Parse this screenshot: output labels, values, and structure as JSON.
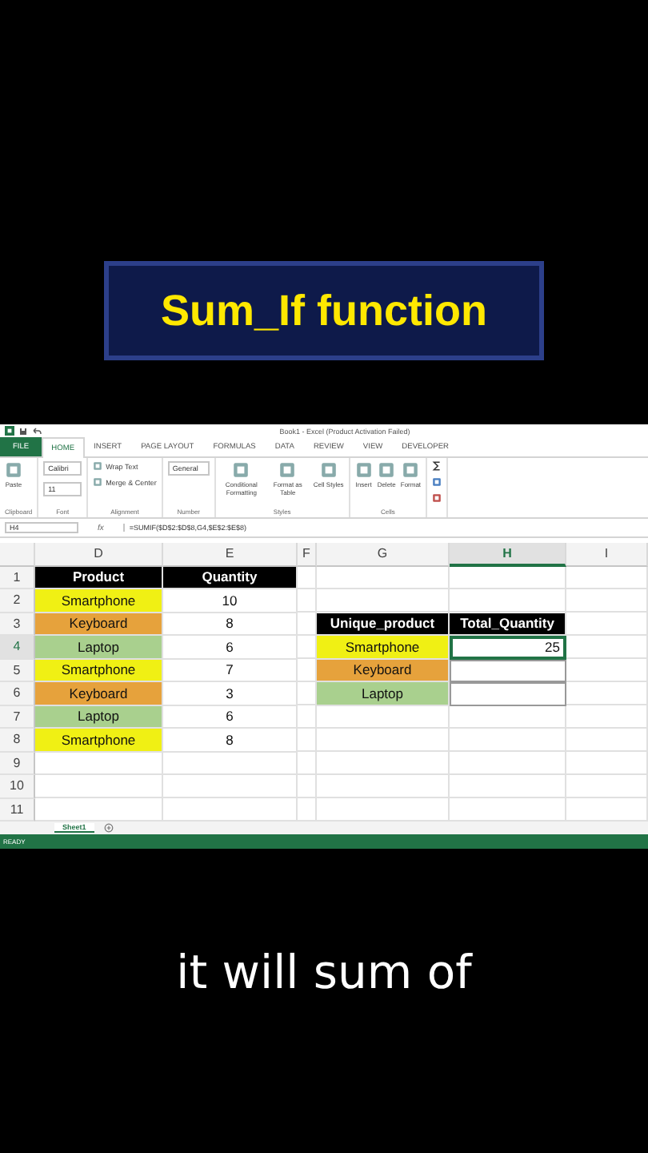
{
  "banner": {
    "title": "Sum_If function"
  },
  "window": {
    "title": "Book1 - Excel (Product Activation Failed)"
  },
  "tabs": [
    {
      "label": "FILE",
      "selected": false,
      "kind": "file"
    },
    {
      "label": "HOME",
      "selected": true,
      "kind": "tab"
    },
    {
      "label": "INSERT",
      "selected": false,
      "kind": "tab"
    },
    {
      "label": "PAGE LAYOUT",
      "selected": false,
      "kind": "tab"
    },
    {
      "label": "FORMULAS",
      "selected": false,
      "kind": "tab"
    },
    {
      "label": "DATA",
      "selected": false,
      "kind": "tab"
    },
    {
      "label": "REVIEW",
      "selected": false,
      "kind": "tab"
    },
    {
      "label": "VIEW",
      "selected": false,
      "kind": "tab"
    },
    {
      "label": "DEVELOPER",
      "selected": false,
      "kind": "tab"
    }
  ],
  "ribbon": {
    "groups": [
      {
        "label": "Clipboard",
        "items": [
          {
            "text": "Paste",
            "kind": "large"
          }
        ]
      },
      {
        "label": "Font",
        "items": [
          {
            "text": "Calibri",
            "kind": "dropdown"
          },
          {
            "text": "11",
            "kind": "dropdown"
          }
        ]
      },
      {
        "label": "Alignment",
        "items": [
          {
            "text": "Wrap Text",
            "kind": "small"
          },
          {
            "text": "Merge & Center",
            "kind": "small"
          }
        ]
      },
      {
        "label": "Number",
        "items": [
          {
            "text": "General",
            "kind": "dropdown"
          }
        ]
      },
      {
        "label": "Styles",
        "items": [
          {
            "text": "Conditional Formatting",
            "kind": "large"
          },
          {
            "text": "Format as Table",
            "kind": "large"
          },
          {
            "text": "Cell Styles",
            "kind": "large"
          }
        ]
      },
      {
        "label": "Cells",
        "items": [
          {
            "text": "Insert",
            "kind": "large"
          },
          {
            "text": "Delete",
            "kind": "large"
          },
          {
            "text": "Format",
            "kind": "large"
          }
        ]
      }
    ]
  },
  "formula_bar": {
    "name_box": "H4",
    "fx": "fx",
    "formula": "=SUMIF($D$2:$D$8,G4,$E$2:$E$8)"
  },
  "columns": [
    {
      "label": "D",
      "selected": false
    },
    {
      "label": "E",
      "selected": false
    },
    {
      "label": "F",
      "selected": false
    },
    {
      "label": "G",
      "selected": false
    },
    {
      "label": "H",
      "selected": true
    },
    {
      "label": "I",
      "selected": false
    }
  ],
  "rows": [
    {
      "number": "1",
      "selected": false,
      "d": {
        "text": "Product",
        "kind": "header",
        "selected": false
      },
      "e": {
        "text": "Quantity",
        "kind": "header",
        "selected": false
      }
    },
    {
      "number": "2",
      "selected": false,
      "d": {
        "text": "Smartphone",
        "kind": "product",
        "color": "#f0f014",
        "selected": false
      },
      "e": {
        "text": "10",
        "kind": "value",
        "selected": false
      }
    },
    {
      "number": "3",
      "selected": false,
      "d": {
        "text": "Keyboard",
        "kind": "product",
        "color": "#e6a23c",
        "selected": false
      },
      "e": {
        "text": "8",
        "kind": "value",
        "selected": false
      },
      "g": {
        "text": "Unique_product",
        "kind": "header",
        "selected": false
      },
      "h": {
        "text": "Total_Quantity",
        "kind": "header",
        "selected": false
      }
    },
    {
      "number": "4",
      "selected": true,
      "d": {
        "text": "Laptop",
        "kind": "product",
        "color": "#a9d08e",
        "selected": false
      },
      "e": {
        "text": "6",
        "kind": "value",
        "selected": false
      },
      "g": {
        "text": "Smartphone",
        "kind": "product",
        "color": "#f0f014",
        "selected": false
      },
      "h": {
        "text": "25",
        "kind": "number",
        "selected": true
      }
    },
    {
      "number": "5",
      "selected": false,
      "d": {
        "text": "Smartphone",
        "kind": "product",
        "color": "#f0f014",
        "selected": false
      },
      "e": {
        "text": "7",
        "kind": "value",
        "selected": false
      },
      "g": {
        "text": "Keyboard",
        "kind": "product",
        "color": "#e6a23c",
        "selected": false
      },
      "h": {
        "kind": "number",
        "selected": false
      }
    },
    {
      "number": "6",
      "selected": false,
      "d": {
        "text": "Keyboard",
        "kind": "product",
        "color": "#e6a23c",
        "selected": false
      },
      "e": {
        "text": "3",
        "kind": "value",
        "selected": false
      },
      "g": {
        "text": "Laptop",
        "kind": "product",
        "color": "#a9d08e",
        "selected": false
      },
      "h": {
        "kind": "number",
        "selected": false
      }
    },
    {
      "number": "7",
      "selected": false,
      "d": {
        "text": "Laptop",
        "kind": "product",
        "color": "#a9d08e",
        "selected": false
      },
      "e": {
        "text": "6",
        "kind": "value",
        "selected": false
      }
    },
    {
      "number": "8",
      "selected": false,
      "d": {
        "text": "Smartphone",
        "kind": "product",
        "color": "#f0f014",
        "selected": false
      },
      "e": {
        "text": "8",
        "kind": "value",
        "selected": false
      }
    },
    {
      "number": "9",
      "selected": false
    },
    {
      "number": "10",
      "selected": false
    },
    {
      "number": "11",
      "selected": false
    }
  ],
  "sheet_tabs": [
    {
      "label": "Sheet1",
      "selected": true
    }
  ],
  "status_bar": {
    "text": "READY"
  },
  "caption": {
    "text": "it will sum of"
  }
}
